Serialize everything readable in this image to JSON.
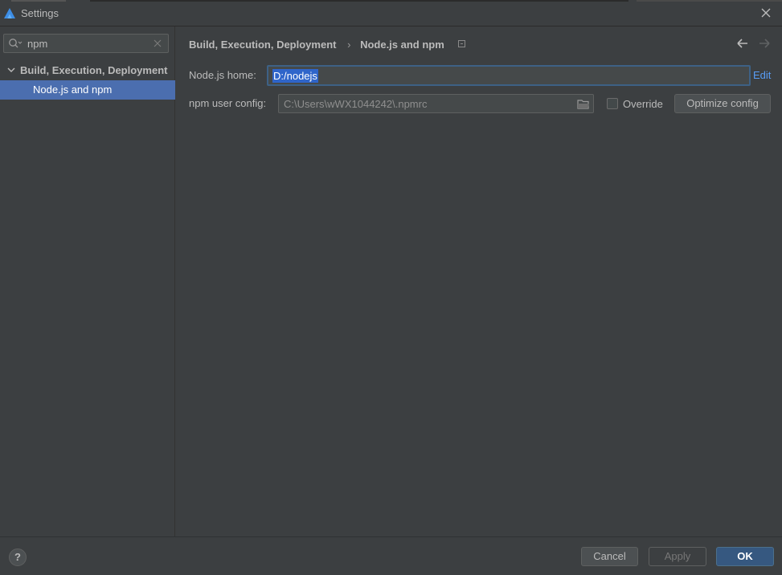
{
  "window": {
    "title": "Settings",
    "close_icon": "close-icon",
    "app_icon": "app-logo-icon"
  },
  "sidebar": {
    "search": {
      "value": "npm",
      "icon": "search-icon",
      "clear_icon": "clear-icon"
    },
    "tree": {
      "group_label": "Build, Execution, Deployment",
      "group_expanded": true,
      "items": [
        {
          "label": "Node.js and npm",
          "selected": true
        }
      ]
    }
  },
  "main": {
    "breadcrumb": {
      "parent": "Build, Execution, Deployment",
      "separator": "›",
      "current": "Node.js and npm"
    },
    "node_home": {
      "label": "Node.js home:",
      "value": "D:/nodejs",
      "edit_label": "Edit"
    },
    "npm_config": {
      "label": "npm user config:",
      "value": "C:\\Users\\wWX1044242\\.npmrc",
      "override_label": "Override",
      "override_checked": false,
      "optimize_label": "Optimize config"
    }
  },
  "footer": {
    "help_label": "?",
    "cancel_label": "Cancel",
    "apply_label": "Apply",
    "ok_label": "OK"
  },
  "colors": {
    "background": "#3c3f41",
    "selection": "#4b6eaf",
    "text_selection": "#2f65ca",
    "link": "#589df6",
    "ok_button": "#365880"
  }
}
